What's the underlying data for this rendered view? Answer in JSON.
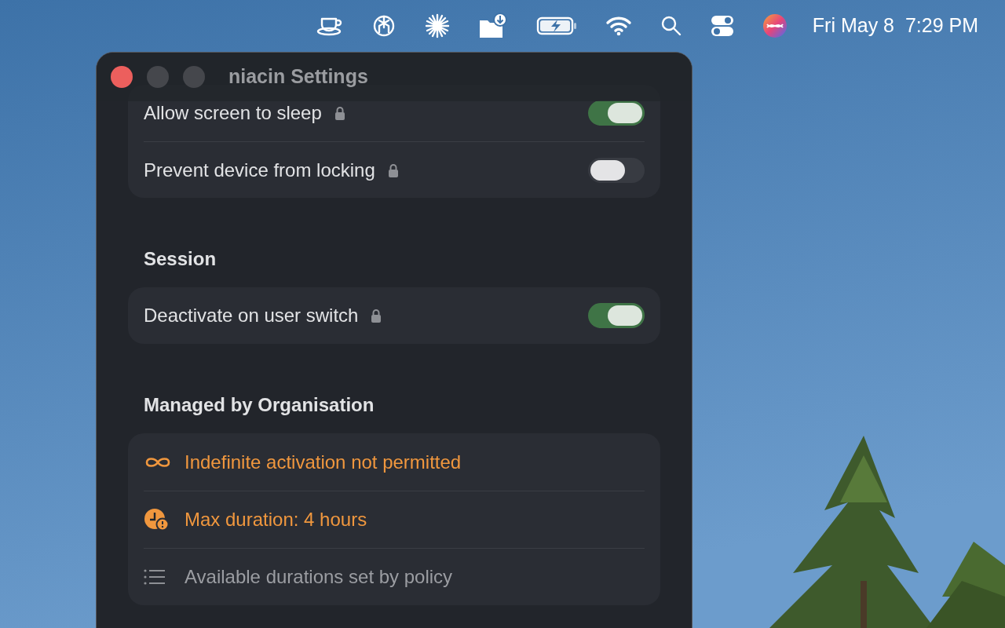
{
  "menu_bar": {
    "icons": [
      {
        "kind": "cup"
      },
      {
        "kind": "knot"
      },
      {
        "kind": "burst"
      },
      {
        "kind": "folder"
      },
      {
        "kind": "battery"
      },
      {
        "kind": "wifi"
      },
      {
        "kind": "search"
      },
      {
        "kind": "switches"
      },
      {
        "kind": "orb"
      }
    ],
    "clock": "Fri May 8  7:29 PM"
  },
  "window": {
    "title": "niacin Settings",
    "sections": [
      {
        "toggles": [
          {
            "label": "Allow screen to sleep",
            "locked": true,
            "on": true
          },
          {
            "label": "Prevent device from locking",
            "locked": true,
            "on": false
          }
        ]
      },
      {
        "heading": "Session",
        "toggles": [
          {
            "label": "Deactivate on user switch",
            "locked": true,
            "on": true
          }
        ]
      },
      {
        "heading": "Managed by Organisation",
        "policies": [
          {
            "kind": "infinity",
            "label": "Indefinite activation not permitted",
            "warning": true
          },
          {
            "kind": "clock",
            "label": "Max duration: 4 hours",
            "warning": true
          },
          {
            "kind": "list",
            "label": "Available durations set by policy",
            "warning": false
          }
        ]
      }
    ]
  }
}
